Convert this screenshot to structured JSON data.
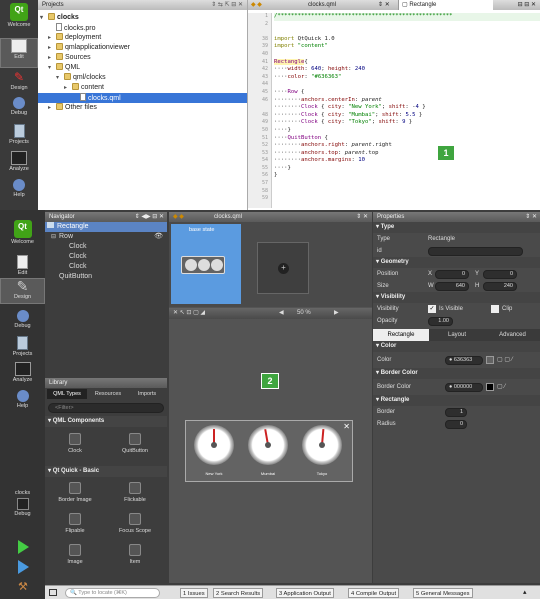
{
  "modes_top": [
    {
      "label": "Welcome",
      "icon": "qt-logo-icon"
    },
    {
      "label": "Edit",
      "icon": "edit-icon"
    },
    {
      "label": "Design",
      "icon": "design-icon"
    },
    {
      "label": "Debug",
      "icon": "debug-icon"
    },
    {
      "label": "Projects",
      "icon": "projects-icon"
    },
    {
      "label": "Analyze",
      "icon": "analyze-icon"
    },
    {
      "label": "Help",
      "icon": "help-icon"
    }
  ],
  "modes_bottom": [
    {
      "label": "Welcome"
    },
    {
      "label": "Edit"
    },
    {
      "label": "Design"
    },
    {
      "label": "Debug"
    },
    {
      "label": "Projects"
    },
    {
      "label": "Analyze"
    },
    {
      "label": "Help"
    }
  ],
  "projects": {
    "header": "Projects",
    "tree": [
      "clocks",
      "clocks.pro",
      "deployment",
      "qmlapplicationviewer",
      "Sources",
      "QML",
      "qml/clocks",
      "content",
      "clocks.qml",
      "Other files"
    ]
  },
  "editor": {
    "file": "clocks.qml",
    "symbol": "Rectangle",
    "lines": [
      "1",
      "2",
      "",
      "38",
      "39",
      "40",
      "41",
      "42",
      "43",
      "44",
      "45",
      "46",
      "",
      "48",
      "49",
      "50",
      "51",
      "52",
      "53",
      "54",
      "55",
      "56",
      "57",
      "58",
      "59",
      "60",
      "61",
      "62"
    ]
  },
  "badges": {
    "one": "1",
    "two": "2"
  },
  "navigator": {
    "header": "Navigator",
    "items": [
      "Rectangle",
      "Row",
      "Clock",
      "Clock",
      "Clock",
      "QuitButton"
    ]
  },
  "form": {
    "file": "clocks.qml",
    "state": "base state",
    "zoom": "50 %"
  },
  "clocks": [
    "New York",
    "Mumbai",
    "Tokyo"
  ],
  "library": {
    "header": "Library",
    "tabs": [
      "QML Types",
      "Resources",
      "Imports"
    ],
    "filter": "<Filter>",
    "sec1": "QML Components",
    "sec2": "Qt Quick - Basic",
    "items": [
      "Clock",
      "QuitButton",
      "Border Image",
      "Flickable",
      "Flipable",
      "Focus Scope",
      "Image",
      "Item"
    ]
  },
  "properties": {
    "header": "Properties",
    "type_sec": "Type",
    "type_label": "Type",
    "type_value": "Rectangle",
    "id_label": "id",
    "geo_sec": "Geometry",
    "position": "Position",
    "x": "X",
    "xv": "0",
    "y": "Y",
    "yv": "0",
    "size": "Size",
    "w": "W",
    "wv": "640",
    "h": "H",
    "hv": "240",
    "vis_sec": "Visibility",
    "visibility": "Visibility",
    "is_visible": "Is Visible",
    "clip": "Clip",
    "opacity": "Opacity",
    "opv": "1.00",
    "tabs": [
      "Rectangle",
      "Layout",
      "Advanced"
    ],
    "color_sec": "Color",
    "color_label": "Color",
    "color_value": "636363",
    "bc_sec": "Border Color",
    "bc_label": "Border Color",
    "bc_value": "000000",
    "rect_sec": "Rectangle",
    "border": "Border",
    "border_v": "1",
    "radius": "Radius",
    "radius_v": "0"
  },
  "status": {
    "locate": "Type to locate (⌘K)",
    "tabs": [
      "1 Issues",
      "2 Search Results",
      "3 Application Output",
      "4 Compile Output",
      "5 General Messages"
    ]
  },
  "run": {
    "label": "clocks",
    "sub": "Debug"
  },
  "colors": {
    "swatch": "#636363",
    "border_swatch": "#000000"
  }
}
